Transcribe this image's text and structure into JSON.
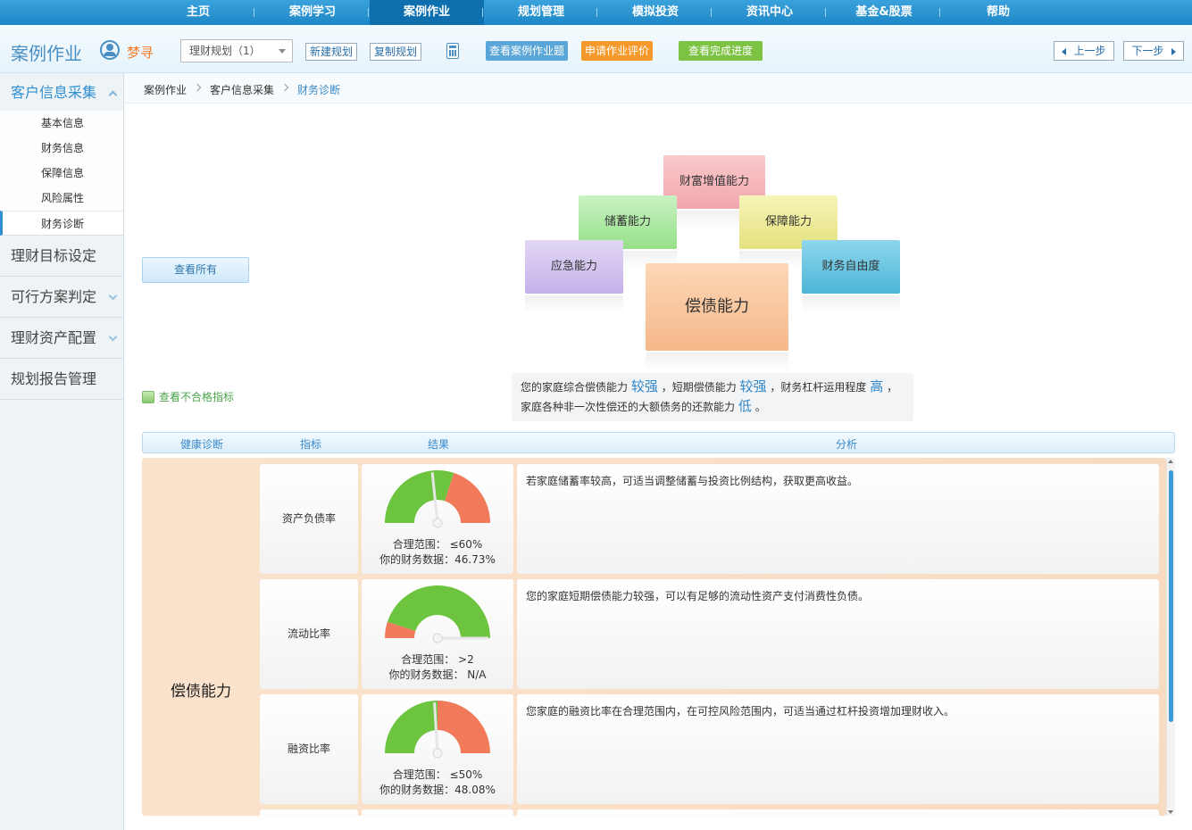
{
  "nav": {
    "items": [
      "主页",
      "案例学习",
      "案例作业",
      "规划管理",
      "模拟投资",
      "资讯中心",
      "基金&股票",
      "帮助"
    ],
    "active_index": 2
  },
  "toolbar": {
    "module_title": "案例作业",
    "user_name": "梦寻",
    "plan_select": "理财规划（1）",
    "new_plan": "新建规划",
    "copy_plan": "复制规划",
    "view_questions": "查看案例作业题",
    "apply_review": "申请作业评价",
    "view_progress": "查看完成进度",
    "prev": "上一步",
    "next": "下一步",
    "colors": {
      "view_questions": "#5aa6d8",
      "apply_review": "#f59a2a",
      "view_progress": "#7cc243"
    }
  },
  "sidebar": {
    "open_group": "客户信息采集",
    "sub_items": [
      "基本信息",
      "财务信息",
      "保障信息",
      "风险属性",
      "财务诊断"
    ],
    "active_sub_index": 4,
    "groups": [
      "理财目标设定",
      "可行方案判定",
      "理财资产配置",
      "规划报告管理"
    ]
  },
  "breadcrumb": [
    "案例作业",
    "客户信息采集",
    "财务诊断"
  ],
  "view_all": "查看所有",
  "diagram": {
    "wealth_growth": "财富增值能力",
    "savings": "储蓄能力",
    "protection": "保障能力",
    "emergency": "应急能力",
    "financial_freedom": "财务自由度",
    "solvency": "偿债能力"
  },
  "summary": {
    "p1": "您的家庭综合偿债能力",
    "v1": "较强",
    "p2": "，短期偿债能力",
    "v2": "较强",
    "p3": "，财务杠杆运用程度",
    "v3": "高",
    "p4": "，家庭各种非一次性偿还的大额债务的还款能力",
    "v4": "低",
    "p5": "。"
  },
  "failed_link": "查看不合格指标",
  "table": {
    "headers": [
      "健康诊断",
      "指标",
      "结果",
      "分析"
    ],
    "category": "偿债能力",
    "rows": [
      {
        "metric": "资产负债率",
        "range": "合理范围：  ≤60%",
        "data": "你的财务数据：46.73%",
        "gauge_split": 0.6,
        "gauge_value": 0.4673,
        "analysis": "若家庭储蓄率较高，可适当调整储蓄与投资比例结构，获取更高收益。"
      },
      {
        "metric": "流动比率",
        "range": "合理范围：  >2",
        "data": "你的财务数据：  N/A",
        "gauge_split": 0.1,
        "gauge_value": 1.0,
        "analysis": "您的家庭短期偿债能力较强，可以有足够的流动性资产支付消费性负债。"
      },
      {
        "metric": "融资比率",
        "range": "合理范围：  ≤50%",
        "data": "你的财务数据：48.08%",
        "gauge_split": 0.5,
        "gauge_value": 0.4808,
        "analysis": "您家庭的融资比率在合理范围内，在可控风险范围内，可适当通过杠杆投资增加理财收入。"
      }
    ]
  },
  "gauge_colors": {
    "good": "#6cc43f",
    "bad": "#f07a5a"
  }
}
